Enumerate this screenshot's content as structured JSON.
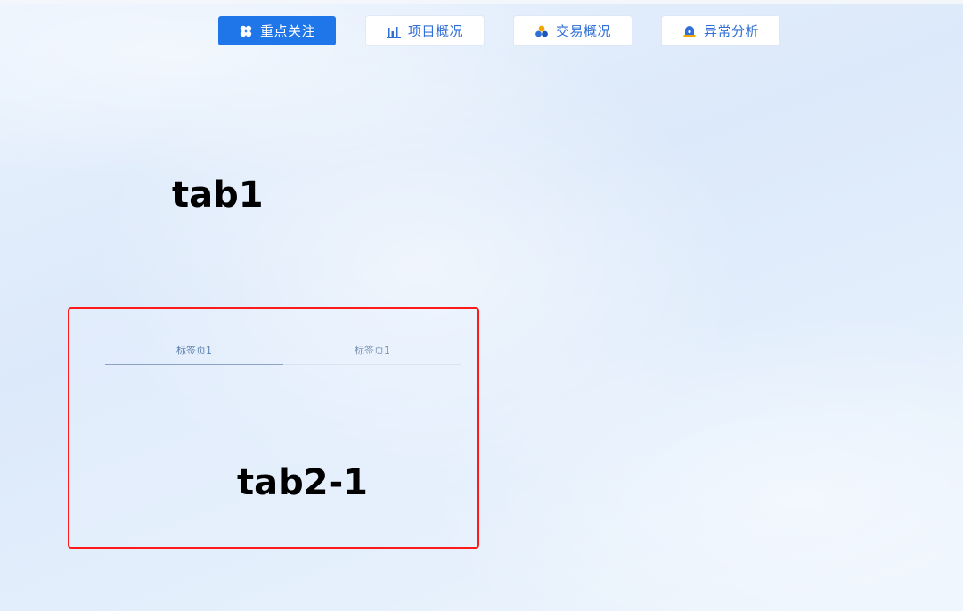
{
  "nav_tabs": [
    {
      "label": "重点关注",
      "icon": "clover-icon",
      "active": true
    },
    {
      "label": "项目概况",
      "icon": "bar-chart-icon",
      "active": false
    },
    {
      "label": "交易概况",
      "icon": "three-circles-icon",
      "active": false
    },
    {
      "label": "异常分析",
      "icon": "alarm-icon",
      "active": false
    }
  ],
  "main": {
    "tab1_text": "tab1"
  },
  "panel": {
    "subtabs": [
      {
        "label": "标签页1"
      },
      {
        "label": "标签页1"
      }
    ],
    "content_text": "tab2-1"
  },
  "colors": {
    "active_tab": "#1f76e8",
    "tab_text": "#2f6fd6",
    "panel_border": "#ff1a1a"
  }
}
